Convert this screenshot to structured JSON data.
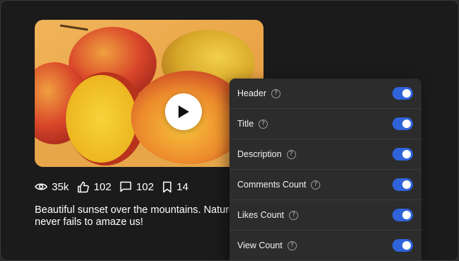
{
  "media": {
    "image_icon": "mango-photo",
    "play_icon": "play-icon"
  },
  "stats": {
    "views": "35k",
    "likes": "102",
    "comments": "102",
    "bookmarks": "14"
  },
  "caption": "Beautiful sunset over the mountains. Nature never fails to amaze us!",
  "settings": {
    "accent": "#2f63d9",
    "items": [
      {
        "label": "Header",
        "enabled": true
      },
      {
        "label": "Title",
        "enabled": true
      },
      {
        "label": "Description",
        "enabled": true
      },
      {
        "label": "Comments Count",
        "enabled": true
      },
      {
        "label": "Likes Count",
        "enabled": true
      },
      {
        "label": "View Count",
        "enabled": true
      }
    ],
    "help_glyph": "?"
  }
}
